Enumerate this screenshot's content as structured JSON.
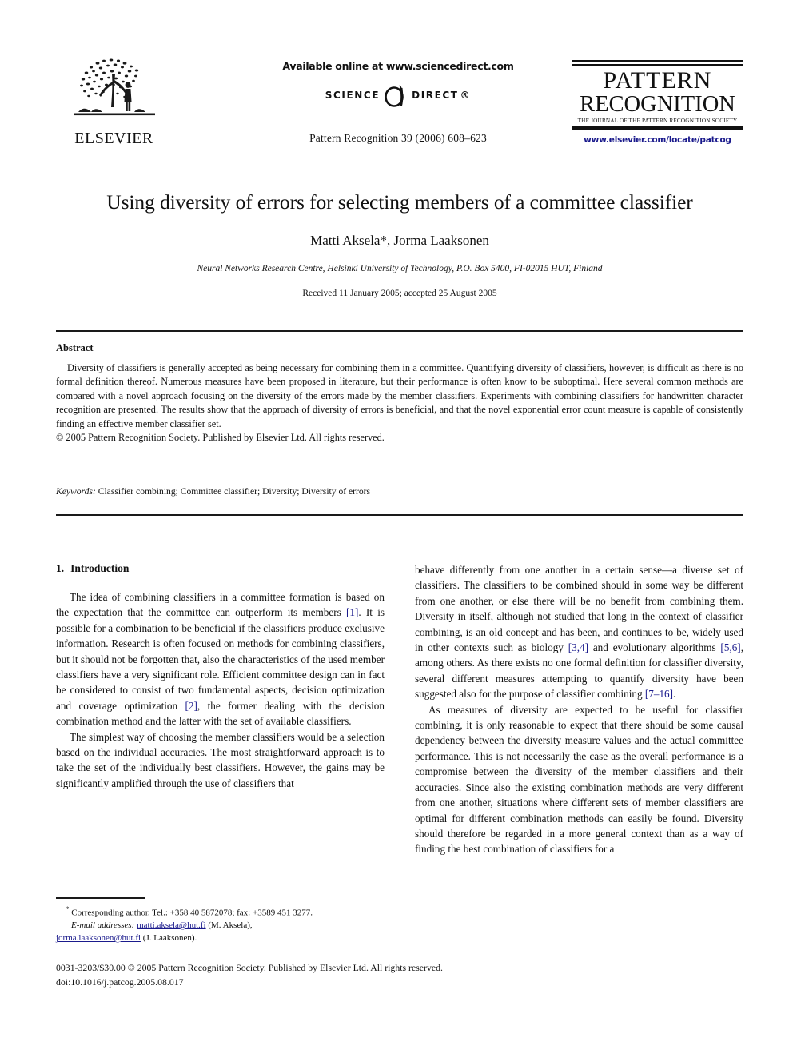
{
  "masthead": {
    "elsevier_wordmark": "ELSEVIER",
    "available_online": "Available online at www.sciencedirect.com",
    "sciencedirect_left": "SCIENCE",
    "sciencedirect_right": "DIRECT",
    "sciencedirect_registered": "®",
    "citation": "Pattern Recognition 39 (2006) 608–623",
    "journal_line1": "PATTERN",
    "journal_line2": "RECOGNITION",
    "journal_tagline": "THE JOURNAL OF THE PATTERN RECOGNITION SOCIETY",
    "journal_url": "www.elsevier.com/locate/patcog",
    "link_color": "#1a1a8c"
  },
  "title_block": {
    "title": "Using diversity of errors for selecting members of a committee classifier",
    "authors": "Matti Aksela*, Jorma Laaksonen",
    "affiliation": "Neural Networks Research Centre, Helsinki University of Technology, P.O. Box 5400, FI-02015 HUT, Finland",
    "dates": "Received 11 January 2005; accepted 25 August 2005"
  },
  "abstract": {
    "heading": "Abstract",
    "body": "Diversity of classifiers is generally accepted as being necessary for combining them in a committee. Quantifying diversity of classifiers, however, is difficult as there is no formal definition thereof. Numerous measures have been proposed in literature, but their performance is often know to be suboptimal. Here several common methods are compared with a novel approach focusing on the diversity of the errors made by the member classifiers. Experiments with combining classifiers for handwritten character recognition are presented. The results show that the approach of diversity of errors is beneficial, and that the novel exponential error count measure is capable of consistently finding an effective member classifier set.",
    "copyright": "© 2005 Pattern Recognition Society. Published by Elsevier Ltd. All rights reserved."
  },
  "keywords": {
    "label": "Keywords:",
    "value": "Classifier combining; Committee classifier; Diversity; Diversity of errors"
  },
  "introduction": {
    "number": "1.",
    "heading": "Introduction",
    "left_paragraphs": [
      {
        "parts": [
          {
            "t": "The idea of combining classifiers in a committee formation is based on the expectation that the committee can outperform its members "
          },
          {
            "t": "[1]",
            "ref": true
          },
          {
            "t": ". It is possible for a combination to be beneficial if the classifiers produce exclusive information. Research is often focused on methods for combining classifiers, but it should not be forgotten that, also the characteristics of the used member classifiers have a very significant role. Efficient committee design can in fact be considered to consist of two fundamental aspects, decision optimization and coverage optimization "
          },
          {
            "t": "[2]",
            "ref": true
          },
          {
            "t": ", the former dealing with the decision combination method and the latter with the set of available classifiers."
          }
        ]
      },
      {
        "parts": [
          {
            "t": "The simplest way of choosing the member classifiers would be a selection based on the individual accuracies. The most straightforward approach is to take the set of the individually best classifiers. However, the gains may be significantly amplified through the use of classifiers that"
          }
        ]
      }
    ],
    "right_paragraphs": [
      {
        "continued": true,
        "parts": [
          {
            "t": "behave differently from one another in a certain sense—a diverse set of classifiers. The classifiers to be combined should in some way be different from one another, or else there will be no benefit from combining them. Diversity in itself, although not studied that long in the context of classifier combining, is an old concept and has been, and continues to be, widely used in other contexts such as biology "
          },
          {
            "t": "[3,4]",
            "ref": true
          },
          {
            "t": " and evolutionary algorithms "
          },
          {
            "t": "[5,6]",
            "ref": true
          },
          {
            "t": ", among others. As there exists no one formal definition for classifier diversity, several different measures attempting to quantify diversity have been suggested also for the purpose of classifier combining "
          },
          {
            "t": "[7–16]",
            "ref": true
          },
          {
            "t": "."
          }
        ]
      },
      {
        "parts": [
          {
            "t": "As measures of diversity are expected to be useful for classifier combining, it is only reasonable to expect that there should be some causal dependency between the diversity measure values and the actual committee performance. This is not necessarily the case as the overall performance is a compromise between the diversity of the member classifiers and their accuracies. Since also the existing combination methods are very different from one another, situations where different sets of member classifiers are optimal for different combination methods can easily be found. Diversity should therefore be regarded in a more general context than as a way of finding the best combination of classifiers for a"
          }
        ]
      }
    ]
  },
  "footnote": {
    "corresponding": "Corresponding author. Tel.: +358 40 5872078; fax: +3589 451 3277.",
    "email_label": "E-mail addresses:",
    "email1": "matti.aksela@hut.fi",
    "email1_owner": "(M. Aksela),",
    "email2": "jorma.laaksonen@hut.fi",
    "email2_owner": "(J. Laaksonen)."
  },
  "page_footer": {
    "issn_line": "0031-3203/$30.00 © 2005 Pattern Recognition Society. Published by Elsevier Ltd. All rights reserved.",
    "doi_line": "doi:10.1016/j.patcog.2005.08.017"
  }
}
